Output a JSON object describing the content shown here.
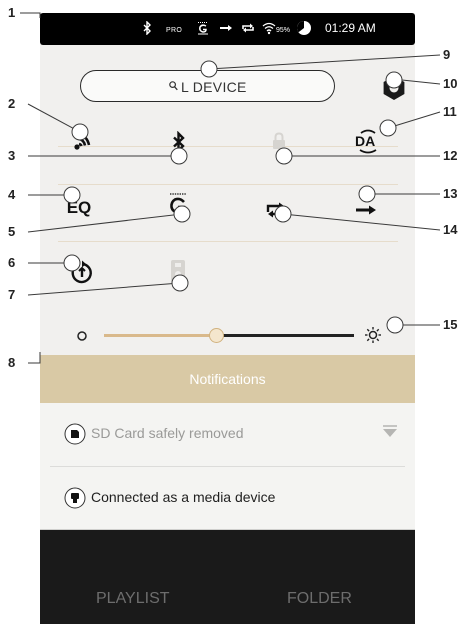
{
  "status_bar": {
    "icons": [
      "bluetooth-icon",
      "pro-icon",
      "gapless-icon",
      "play-mode-icon",
      "repeat-icon",
      "wifi-icon",
      "battery-icon"
    ],
    "pro_text": "PRO",
    "battery": "95%",
    "time": "01:29 AM"
  },
  "search": {
    "icon": "search-icon",
    "text": "L DEVICE"
  },
  "settings": {
    "icon": "gear-icon"
  },
  "quick_buttons": {
    "wifi": "wifi-icon",
    "bluetooth": "bluetooth-icon",
    "lock": "lock-icon",
    "dac": "DA",
    "eq": "EQ",
    "gapless": "G",
    "repeat": "repeat-icon",
    "play_mode": "play-order-icon",
    "update": "update-icon",
    "usb_mass_storage": "usb-storage-icon"
  },
  "volume": {
    "level": 0.45,
    "min_icon": "volume-min-icon",
    "max_icon": "volume-max-icon"
  },
  "notifications": {
    "title": "Notifications",
    "items": [
      {
        "icon": "sd-card-icon",
        "text": "SD Card safely removed"
      },
      {
        "icon": "usb-icon",
        "text": "Connected as a media device"
      }
    ]
  },
  "bottom_bar": {
    "playlist": "PLAYLIST",
    "folder": "FOLDER"
  },
  "callouts": [
    "1",
    "2",
    "3",
    "4",
    "5",
    "6",
    "7",
    "8",
    "9",
    "10",
    "11",
    "12",
    "13",
    "14",
    "15"
  ],
  "colors": {
    "accent": "#d9b98b",
    "notification_header": "#d9c9a5",
    "status_bar": "#000000"
  }
}
